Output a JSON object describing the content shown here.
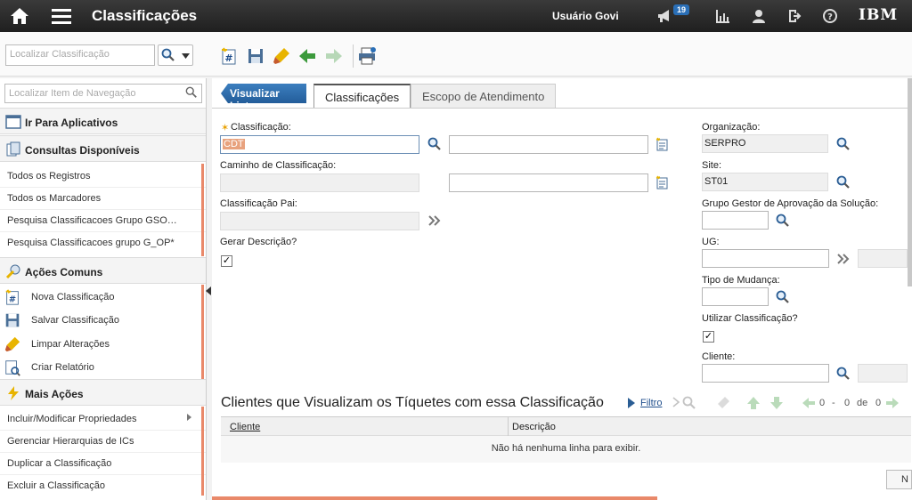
{
  "header": {
    "title": "Classificações",
    "user": "Usuário Govi",
    "notification_count": "19",
    "brand": "IBM"
  },
  "toolbar": {
    "search_placeholder": "Localizar Classificação"
  },
  "sidebar": {
    "search_placeholder": "Localizar Item de Navegação",
    "sections": {
      "goto": "Ir Para Aplicativos",
      "queries": "Consultas Disponíveis",
      "common": "Ações Comuns",
      "more": "Mais Ações"
    },
    "queries": [
      "Todos os Registros",
      "Todos os Marcadores",
      "Pesquisa Classificacoes Grupo GSO…",
      "Pesquisa Classificacoes grupo G_OP*"
    ],
    "common": [
      "Nova Classificação",
      "Salvar Classificação",
      "Limpar Alterações",
      "Criar Relatório"
    ],
    "more": [
      "Incluir/Modificar Propriedades",
      "Gerenciar Hierarquias de ICs",
      "Duplicar a Classificação",
      "Excluir a Classificação"
    ]
  },
  "main": {
    "view_list": "Visualizar Lista",
    "tabs": [
      "Classificações",
      "Escopo de Atendimento"
    ],
    "labels": {
      "classification": "Classificação:",
      "path": "Caminho de Classificação:",
      "parent": "Classificação Pai:",
      "gen_desc": "Gerar Descrição?",
      "org": "Organização:",
      "site": "Site:",
      "approval_group": "Grupo Gestor de Aprovação da Solução:",
      "ug": "UG:",
      "change_type": "Tipo de Mudança:",
      "use_class": "Utilizar Classificação?",
      "client": "Cliente:"
    },
    "values": {
      "classification": "CDT",
      "org": "SERPRO",
      "site": "ST01"
    },
    "table": {
      "title": "Clientes que Visualizam os Tíquetes com essa Classificação",
      "filter": "Filtro",
      "pager_from": "0",
      "pager_dash": "-",
      "pager_to": "0",
      "pager_of": "de",
      "pager_total": "0",
      "col_client": "Cliente",
      "col_desc": "Descrição",
      "empty": "Não há nenhuma linha para exibir."
    },
    "bottom_button": "N"
  },
  "colors": {
    "accent": "#2a6fb7",
    "header_bg": "#2b2b2b",
    "highlight": "#e9896a"
  }
}
